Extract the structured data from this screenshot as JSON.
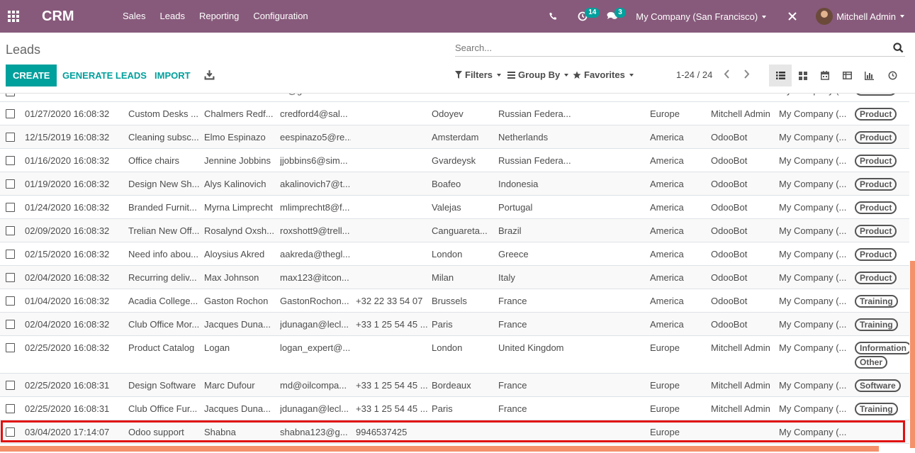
{
  "navbar": {
    "brand": "CRM",
    "menu": [
      "Sales",
      "Leads",
      "Reporting",
      "Configuration"
    ],
    "activity_badge": "14",
    "message_badge": "3",
    "company": "My Company (San Francisco)",
    "user": "Mitchell Admin",
    "color": "#875a7b"
  },
  "control": {
    "title": "Leads",
    "search_placeholder": "Search...",
    "create": "CREATE",
    "generate": "GENERATE LEADS",
    "import": "IMPORT",
    "filters": "Filters",
    "group_by": "Group By",
    "favorites": "Favorites",
    "pager": "1-24 / 24",
    "accent": "#00a09d"
  },
  "rows": [
    {
      "date": "01/27/2020 16:08:32",
      "name": "Custom Desks ...",
      "contact": "Chalmers Redf...",
      "email": "credford4@sal...",
      "phone": "",
      "city": "Odoyev",
      "country": "Russian Federa...",
      "team": "Europe",
      "user": "Mitchell Admin",
      "company": "My Company (...",
      "tags": [
        "Product"
      ]
    },
    {
      "date": "12/15/2019 16:08:32",
      "name": "Cleaning subsc...",
      "contact": "Elmo Espinazo",
      "email": "eespinazo5@re...",
      "phone": "",
      "city": "Amsterdam",
      "country": "Netherlands",
      "team": "America",
      "user": "OdooBot",
      "company": "My Company (...",
      "tags": [
        "Product"
      ]
    },
    {
      "date": "01/16/2020 16:08:32",
      "name": "Office chairs",
      "contact": "Jennine Jobbins",
      "email": "jjobbins6@sim...",
      "phone": "",
      "city": "Gvardeysk",
      "country": "Russian Federa...",
      "team": "America",
      "user": "OdooBot",
      "company": "My Company (...",
      "tags": [
        "Product"
      ]
    },
    {
      "date": "01/19/2020 16:08:32",
      "name": "Design New Sh...",
      "contact": "Alys Kalinovich",
      "email": "akalinovich7@t...",
      "phone": "",
      "city": "Boafeo",
      "country": "Indonesia",
      "team": "America",
      "user": "OdooBot",
      "company": "My Company (...",
      "tags": [
        "Product"
      ]
    },
    {
      "date": "01/24/2020 16:08:32",
      "name": "Branded Furnit...",
      "contact": "Myrna Limprecht",
      "email": "mlimprecht8@f...",
      "phone": "",
      "city": "Valejas",
      "country": "Portugal",
      "team": "America",
      "user": "OdooBot",
      "company": "My Company (...",
      "tags": [
        "Product"
      ]
    },
    {
      "date": "02/09/2020 16:08:32",
      "name": "Trelian New Off...",
      "contact": "Rosalynd Oxsh...",
      "email": "roxshott9@trell...",
      "phone": "",
      "city": "Canguareta...",
      "country": "Brazil",
      "team": "America",
      "user": "OdooBot",
      "company": "My Company (...",
      "tags": [
        "Product"
      ]
    },
    {
      "date": "02/15/2020 16:08:32",
      "name": "Need info abou...",
      "contact": "Aloysius Akred",
      "email": "aakreda@thegl...",
      "phone": "",
      "city": "London",
      "country": "Greece",
      "team": "America",
      "user": "OdooBot",
      "company": "My Company (...",
      "tags": [
        "Product"
      ]
    },
    {
      "date": "02/04/2020 16:08:32",
      "name": "Recurring deliv...",
      "contact": "Max Johnson",
      "email": "max123@itcon...",
      "phone": "",
      "city": "Milan",
      "country": "Italy",
      "team": "America",
      "user": "OdooBot",
      "company": "My Company (...",
      "tags": [
        "Product"
      ]
    },
    {
      "date": "01/04/2020 16:08:32",
      "name": "Acadia College...",
      "contact": "Gaston Rochon",
      "email": "GastonRochon...",
      "phone": "+32 22 33 54 07",
      "city": "Brussels",
      "country": "France",
      "team": "America",
      "user": "OdooBot",
      "company": "My Company (...",
      "tags": [
        "Training"
      ]
    },
    {
      "date": "02/04/2020 16:08:32",
      "name": "Club Office Mor...",
      "contact": "Jacques Duna...",
      "email": "jdunagan@lecl...",
      "phone": "+33 1 25 54 45 ...",
      "city": "Paris",
      "country": "France",
      "team": "America",
      "user": "OdooBot",
      "company": "My Company (...",
      "tags": [
        "Training"
      ]
    },
    {
      "date": "02/25/2020 16:08:32",
      "name": "Product Catalog",
      "contact": "Logan",
      "email": "logan_expert@...",
      "phone": "",
      "city": "London",
      "country": "United Kingdom",
      "team": "Europe",
      "user": "Mitchell Admin",
      "company": "My Company (...",
      "tags": [
        "Information",
        "Other"
      ]
    },
    {
      "date": "02/25/2020 16:08:31",
      "name": "Design Software",
      "contact": "Marc Dufour",
      "email": "md@oilcompa...",
      "phone": "+33 1 25 54 45 ...",
      "city": "Bordeaux",
      "country": "France",
      "team": "Europe",
      "user": "Mitchell Admin",
      "company": "My Company (...",
      "tags": [
        "Software"
      ]
    },
    {
      "date": "02/25/2020 16:08:31",
      "name": "Club Office Fur...",
      "contact": "Jacques Duna...",
      "email": "jdunagan@lecl...",
      "phone": "+33 1 25 54 45 ...",
      "city": "Paris",
      "country": "France",
      "team": "Europe",
      "user": "Mitchell Admin",
      "company": "My Company (...",
      "tags": [
        "Training"
      ]
    },
    {
      "date": "03/04/2020 17:14:07",
      "name": "Odoo support",
      "contact": "Shabna",
      "email": "shabna123@g...",
      "phone": "9946537425",
      "city": "",
      "country": "",
      "team": "Europe",
      "user": "",
      "company": "My Company (...",
      "tags": []
    }
  ],
  "partial_row": {
    "company": "My Company (...",
    "email": "...@g..."
  }
}
